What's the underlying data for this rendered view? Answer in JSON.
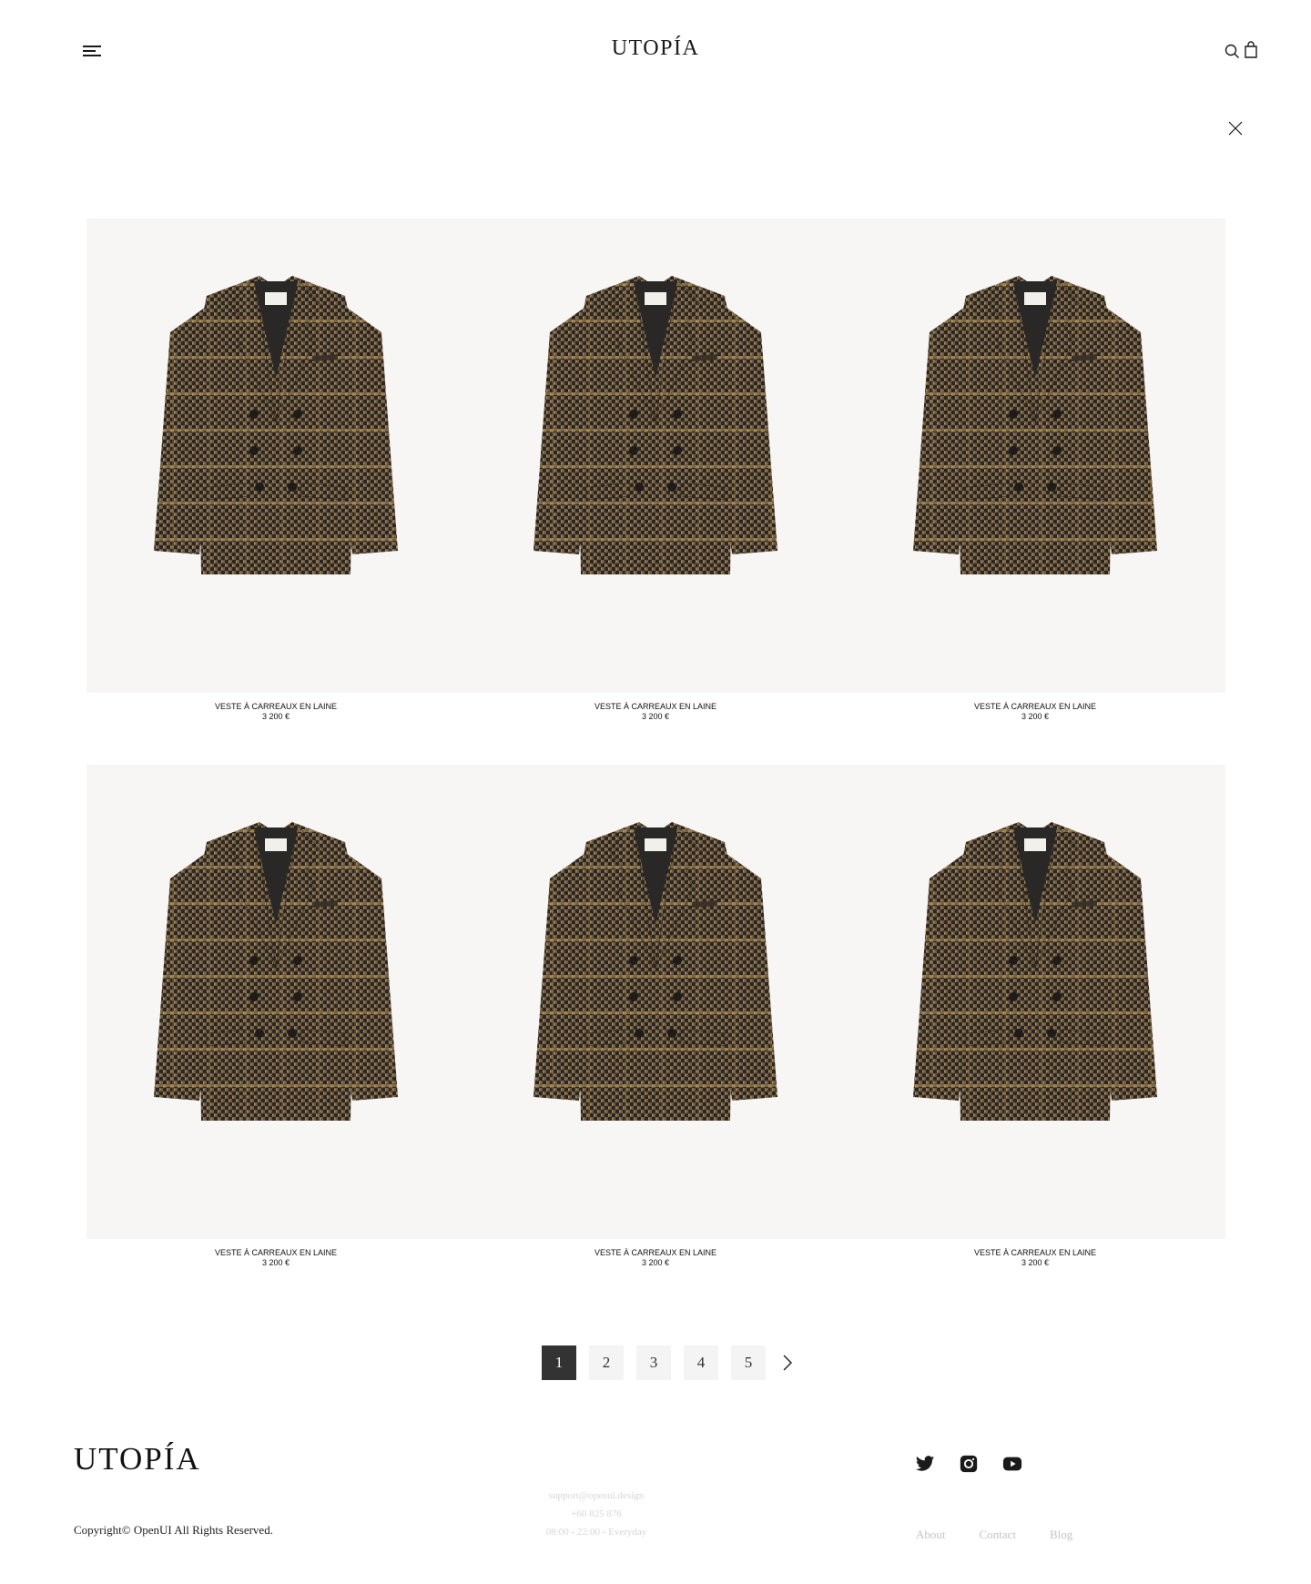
{
  "header": {
    "logo": "UTOPÍA",
    "icons": [
      "menu-icon",
      "search-icon",
      "bag-icon",
      "close-icon"
    ]
  },
  "products": [
    {
      "name": "VESTE À CARREAUX EN LAINE",
      "price": "3 200 €"
    },
    {
      "name": "VESTE À CARREAUX EN LAINE",
      "price": "3 200 €"
    },
    {
      "name": "VESTE À CARREAUX EN LAINE",
      "price": "3 200 €"
    },
    {
      "name": "VESTE À CARREAUX EN LAINE",
      "price": "3 200 €"
    },
    {
      "name": "VESTE À CARREAUX EN LAINE",
      "price": "3 200 €"
    },
    {
      "name": "VESTE À CARREAUX EN LAINE",
      "price": "3 200 €"
    }
  ],
  "pagination": {
    "pages": [
      "1",
      "2",
      "3",
      "4",
      "5"
    ],
    "current": "1",
    "next_icon": "chevron-right-icon"
  },
  "footer": {
    "logo": "UTOPÍA",
    "copyright": "Copyright© OpenUI All Rights Reserved.",
    "email": "support@openui.design",
    "phone": "+60 825 876",
    "hours": "08:00 - 22:00 - Everyday",
    "social": [
      "twitter-icon",
      "instagram-icon",
      "youtube-icon"
    ],
    "links": [
      "About",
      "Contact",
      "Blog"
    ]
  },
  "colors": {
    "text": "#1a1a1a",
    "image_bg": "#f7f6f4",
    "page_active_bg": "#333333",
    "page_bg": "#f4f4f4",
    "footer_muted": "#c4c4c4"
  }
}
